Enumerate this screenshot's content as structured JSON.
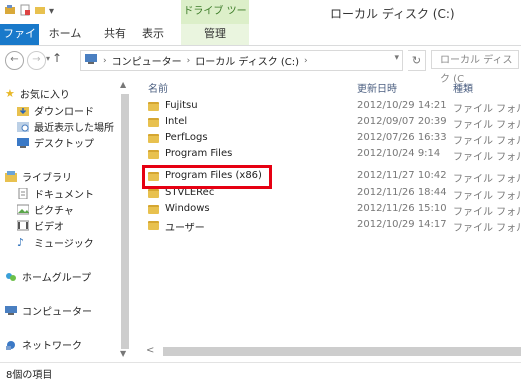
{
  "window": {
    "title": "ローカル ディスク (C:)",
    "context_tab": "ドライブ ツール"
  },
  "ribbon": {
    "tabs": [
      "ファイル",
      "ホーム",
      "共有",
      "表示",
      "管理"
    ]
  },
  "address": {
    "crumbs": [
      "コンピューター",
      "ローカル ディスク (C:)"
    ],
    "search_placeholder": "ローカル ディスク (C"
  },
  "navpane": {
    "favorites": {
      "label": "お気に入り",
      "items": [
        "ダウンロード",
        "最近表示した場所",
        "デスクトップ"
      ]
    },
    "libraries": {
      "label": "ライブラリ",
      "items": [
        "ドキュメント",
        "ピクチャ",
        "ビデオ",
        "ミュージック"
      ]
    },
    "homegroup": "ホームグループ",
    "computer": "コンピューター",
    "network": "ネットワーク"
  },
  "columns": {
    "name": "名前",
    "date": "更新日時",
    "type": "種類"
  },
  "files": [
    {
      "name": "Fujitsu",
      "date": "2012/10/29 14:21",
      "type": "ファイル フォルダー"
    },
    {
      "name": "Intel",
      "date": "2012/09/07 20:39",
      "type": "ファイル フォルダー"
    },
    {
      "name": "PerfLogs",
      "date": "2012/07/26 16:33",
      "type": "ファイル フォルダー"
    },
    {
      "name": "Program Files",
      "date": "2012/10/24 9:14",
      "type": "ファイル フォルダー"
    },
    {
      "name": "Program Files (x86)",
      "date": "2012/11/27 10:42",
      "type": "ファイル フォルダー"
    },
    {
      "name": "STVLERec",
      "date": "2012/11/26 18:44",
      "type": "ファイル フォルダー"
    },
    {
      "name": "Windows",
      "date": "2012/11/26 15:10",
      "type": "ファイル フォルダー"
    },
    {
      "name": "ユーザー",
      "date": "2012/10/29 14:17",
      "type": "ファイル フォルダー"
    }
  ],
  "status": {
    "item_count": "8個の項目"
  },
  "colors": {
    "file_tab": "#1979ca",
    "highlight": "#e60012",
    "context_tab": "#dcefc9"
  }
}
